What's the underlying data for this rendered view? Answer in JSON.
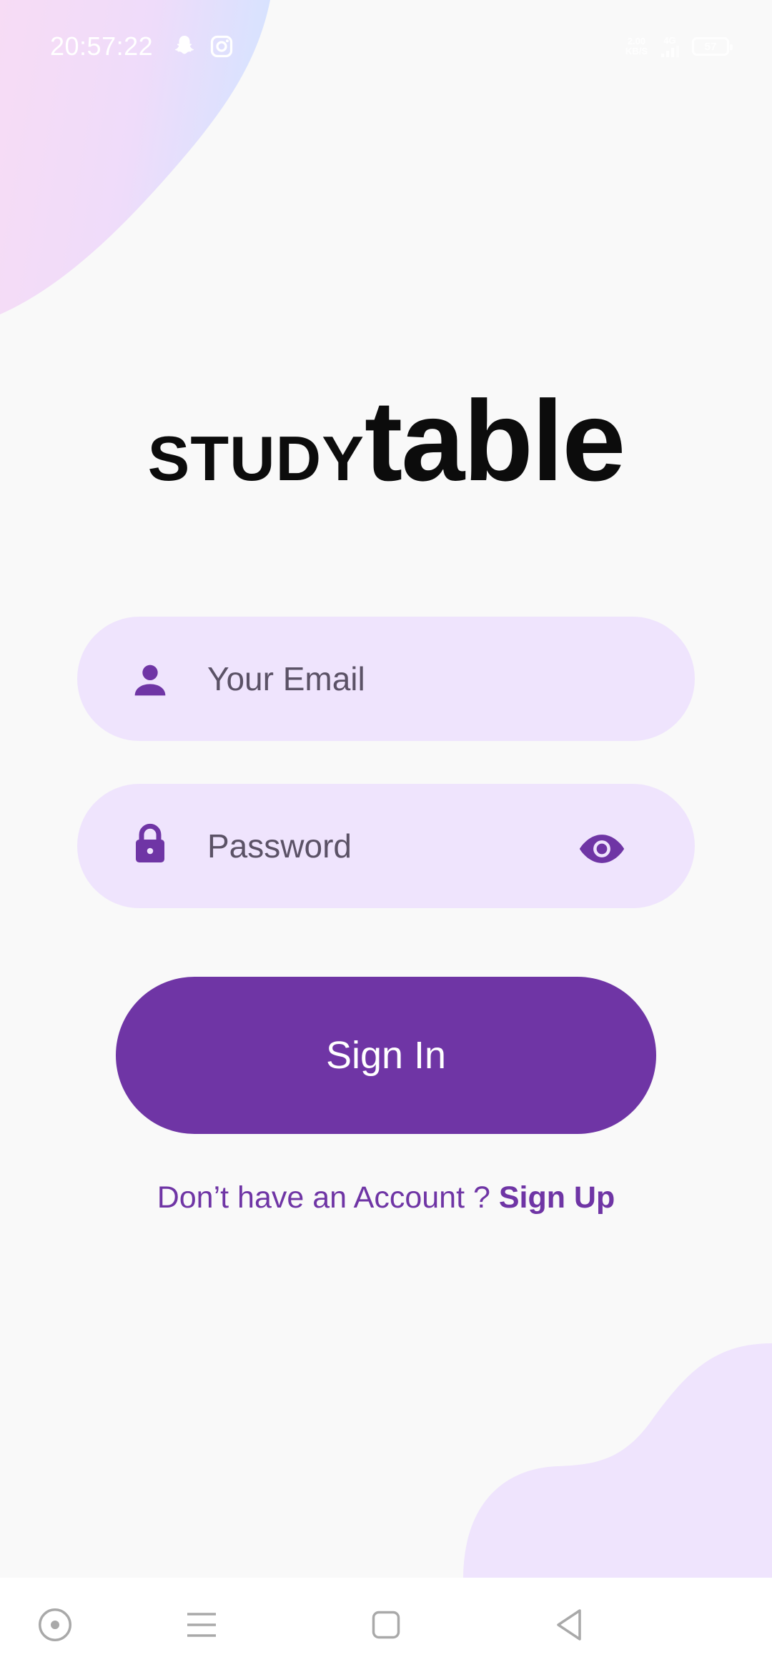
{
  "status_bar": {
    "time": "20:57:22",
    "icons": [
      "snapchat-icon",
      "instagram-icon"
    ],
    "network_speed": [
      "2.00",
      "KB/S"
    ],
    "signal_label": "4G",
    "battery": "57"
  },
  "logo": {
    "part1": "STUDY",
    "part2": "table"
  },
  "email_field": {
    "placeholder": "Your Email",
    "icon": "person-icon"
  },
  "password_field": {
    "placeholder": "Password",
    "icon": "lock-icon",
    "toggle_icon": "eye-icon"
  },
  "signin_button": {
    "label": "Sign In"
  },
  "signup_prompt": {
    "text": "Don’t have an Account ? ",
    "link": "Sign Up"
  },
  "nav_bar": {
    "buttons": [
      "assistant-icon",
      "menu-icon",
      "home-icon",
      "back-icon"
    ]
  },
  "colors": {
    "primary": "#6f35a5",
    "field_background": "#efe4fd",
    "background": "#f9f9f9"
  }
}
